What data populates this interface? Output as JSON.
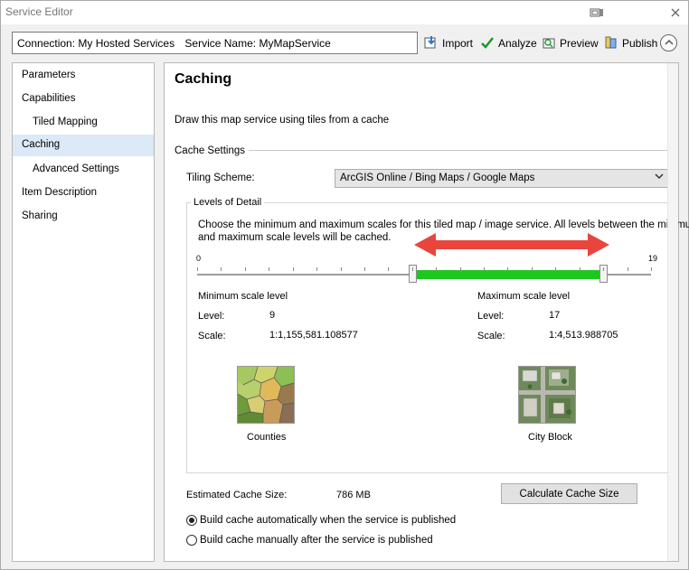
{
  "window": {
    "title": "Service Editor"
  },
  "header": {
    "connection": "Connection: My Hosted Services",
    "service_name": "Service Name: MyMapService"
  },
  "toolbar": {
    "import_label": "Import",
    "analyze_label": "Analyze",
    "preview_label": "Preview",
    "publish_label": "Publish"
  },
  "sidebar": {
    "items": [
      {
        "label": "Parameters"
      },
      {
        "label": "Capabilities"
      },
      {
        "label": "Tiled Mapping"
      },
      {
        "label": "Caching"
      },
      {
        "label": "Advanced Settings"
      },
      {
        "label": "Item Description"
      },
      {
        "label": "Sharing"
      }
    ]
  },
  "caching": {
    "heading": "Caching",
    "description": "Draw this map service using tiles from a cache",
    "cache_settings_label": "Cache Settings",
    "tiling_scheme_label": "Tiling Scheme:",
    "tiling_scheme_value": "ArcGIS Online / Bing Maps / Google Maps",
    "lod": {
      "legend": "Levels of Detail",
      "instructions_line1": "Choose the minimum and maximum scales for this tiled map / image service. All levels between the minimum",
      "instructions_line2": "and maximum scale levels will be cached.",
      "min_tick_label": "0",
      "max_tick_label": "19",
      "slider_min": 0,
      "slider_max": 19,
      "selected_min": 9,
      "selected_max": 17,
      "min_title": "Minimum scale level",
      "max_title": "Maximum scale level",
      "level_label": "Level:",
      "scale_label": "Scale:",
      "min_level": "9",
      "min_scale": "1:1,155,581.108577",
      "max_level": "17",
      "max_scale": "1:4,513.988705",
      "min_preview_caption": "Counties",
      "max_preview_caption": "City Block"
    },
    "estimated_size_label": "Estimated Cache Size:",
    "estimated_size_value": "786 MB",
    "calculate_button": "Calculate Cache Size",
    "radio_auto": "Build cache automatically when the service is published",
    "radio_manual": "Build cache manually after the service is published",
    "radio_selected": "auto"
  },
  "colors": {
    "range_fill": "#1dc71d",
    "arrow": "#e8453c",
    "selected_nav": "#dce9f7"
  }
}
